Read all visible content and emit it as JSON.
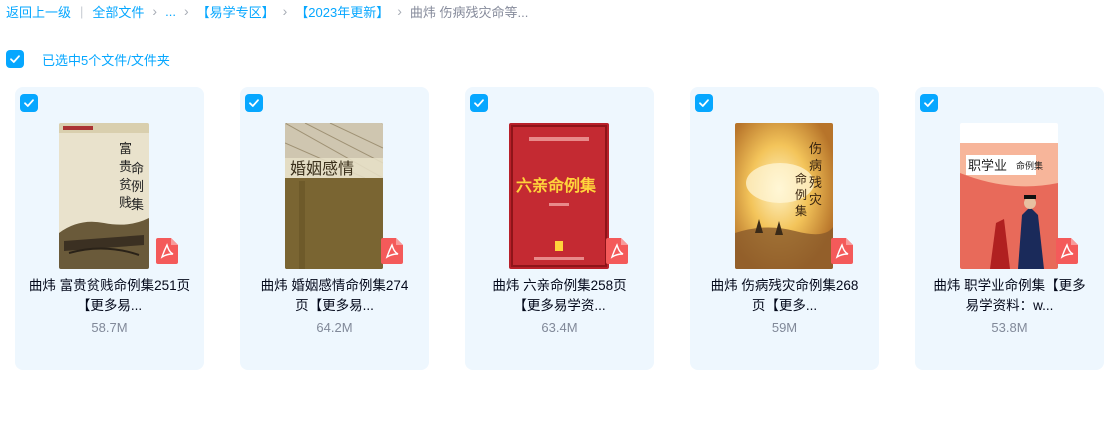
{
  "breadcrumb": {
    "back": "返回上一级",
    "all_files": "全部文件",
    "ellipsis": "...",
    "folder1": "【易学专区】",
    "folder2": "【2023年更新】",
    "current": "曲炜 伤病残灾命等..."
  },
  "selection": {
    "label": "已选中5个文件/文件夹"
  },
  "files": [
    {
      "name_line1": "曲炜 富贵贫贱命例集251页",
      "name_line2": "【更多易...",
      "size": "58.7M",
      "cover_title": "富贵贫贱命例集",
      "file_type": "pdf"
    },
    {
      "name_line1": "曲炜 婚姻感情命例集274",
      "name_line2": "页【更多易...",
      "size": "64.2M",
      "cover_title": "婚姻感情",
      "file_type": "pdf"
    },
    {
      "name_line1": "曲炜 六亲命例集258页",
      "name_line2": "【更多易学资...",
      "size": "63.4M",
      "cover_title": "六亲命例集",
      "file_type": "pdf"
    },
    {
      "name_line1": "曲炜 伤病残灾命例集268",
      "name_line2": "页【更多...",
      "size": "59M",
      "cover_title": "伤病残灾命例集",
      "file_type": "pdf"
    },
    {
      "name_line1": "曲炜 职学业命例集【更多",
      "name_line2": "易学资料：w...",
      "size": "53.8M",
      "cover_title": "职学业命例集",
      "file_type": "pdf"
    }
  ],
  "colors": {
    "accent": "#06a7ff",
    "card_bg": "#eef7fe",
    "pdf_red": "#f45a5a"
  }
}
